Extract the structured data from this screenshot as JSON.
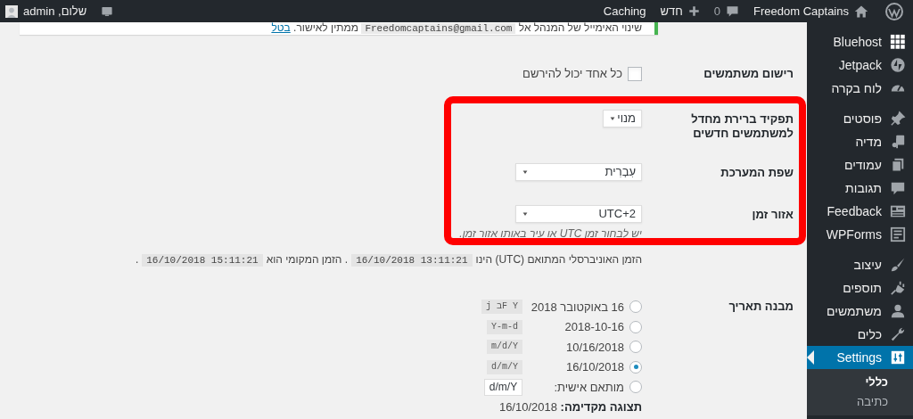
{
  "admin_bar": {
    "site_name": "Freedom Captains",
    "comment_count": "0",
    "new_label": "חדש",
    "caching": "Caching",
    "greeting": "שלום, admin"
  },
  "notice": {
    "text": "שינוי האימייל של המנהל אל",
    "email": "Freedomcaptains@gmail.com",
    "text_after": "ממתין לאישור.",
    "link": "בטל"
  },
  "settings": [
    {
      "kind": "checkbox",
      "label": "רישום משתמשים",
      "option": "כל אחד יכול להירשם",
      "checked": false
    },
    {
      "kind": "short_select",
      "label": "תפקיד ברירת מחדל למשתמשים חדשים",
      "value": "מנוי"
    },
    {
      "kind": "select",
      "label": "שפת המערכת",
      "value": "עִבְרִית"
    },
    {
      "kind": "select",
      "label": "אזור זמן",
      "value": "UTC+2",
      "description": "יש לבחור זמן UTC או עיר באותו אזור זמן."
    }
  ],
  "time_info": {
    "utc_label": "הזמן האוניברסלי המתואם (UTC) הינו",
    "utc": "16/10/2018 13:11:21",
    "local_label": ". הזמן המקומי הוא",
    "local": "16/10/2018 15:11:21",
    "end": "."
  },
  "date_format": {
    "label": "מבנה תאריך",
    "options": [
      {
        "kind": "preset",
        "label": "16 באוקטובר 2018",
        "code": "j בF Y",
        "selected": false
      },
      {
        "kind": "preset",
        "label": "2018-10-16",
        "code": "Y-m-d",
        "selected": false
      },
      {
        "kind": "preset",
        "label": "10/16/2018",
        "code": "m/d/Y",
        "selected": false
      },
      {
        "kind": "preset",
        "label": "16/10/2018",
        "code": "d/m/Y",
        "selected": true
      },
      {
        "kind": "custom",
        "label": "מותאם אישית:",
        "value": "d/m/Y",
        "selected": false
      }
    ],
    "preview_label": "תצוגה מקדימה:",
    "preview": "16/10/2018"
  },
  "sidebar": {
    "groups": [
      [
        {
          "label": "Bluehost",
          "selected": false
        },
        {
          "label": "Jetpack",
          "selected": false
        },
        {
          "label": "לוח בקרה",
          "selected": false
        }
      ],
      [
        {
          "label": "פוסטים",
          "selected": false
        },
        {
          "label": "מדיה",
          "selected": false
        },
        {
          "label": "עמודים",
          "selected": false
        },
        {
          "label": "תגובות",
          "selected": false
        },
        {
          "label": "Feedback",
          "selected": false
        },
        {
          "label": "WPForms",
          "selected": false
        }
      ],
      [
        {
          "label": "עיצוב",
          "selected": false
        },
        {
          "label": "תוספים",
          "selected": false
        },
        {
          "label": "משתמשים",
          "selected": false
        },
        {
          "label": "כלים",
          "selected": false
        },
        {
          "label": "Settings",
          "selected": true,
          "children": [
            {
              "label": "כללי",
              "selected": true
            },
            {
              "label": "כתיבה",
              "selected": false
            }
          ]
        }
      ]
    ]
  }
}
